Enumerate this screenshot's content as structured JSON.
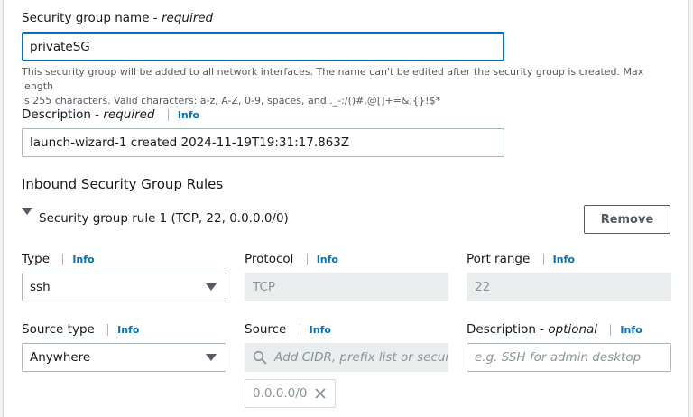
{
  "name_field": {
    "label": "Security group name - ",
    "required": "required",
    "value": "privateSG",
    "hint_line1": "This security group will be added to all network interfaces. The name can't be edited after the security group is created. Max length",
    "hint_line2": "is 255 characters. Valid characters: a-z, A-Z, 0-9, spaces, and ._-:/()#,@[]+=&;{}!$*"
  },
  "description_field": {
    "label": "Description - ",
    "required": "required",
    "info": "Info",
    "value": "launch-wizard-1 created 2024-11-19T19:31:17.863Z"
  },
  "inbound": {
    "heading": "Inbound Security Group Rules",
    "rule_title": "Security group rule 1 (TCP, 22, 0.0.0.0/0)",
    "remove_label": "Remove",
    "type": {
      "label": "Type",
      "info": "Info",
      "value": "ssh"
    },
    "protocol": {
      "label": "Protocol",
      "info": "Info",
      "value": "TCP"
    },
    "port_range": {
      "label": "Port range",
      "info": "Info",
      "value": "22"
    },
    "source_type": {
      "label": "Source type",
      "info": "Info",
      "value": "Anywhere"
    },
    "source": {
      "label": "Source",
      "info": "Info",
      "placeholder": "Add CIDR, prefix list or securit",
      "chip": "0.0.0.0/0"
    },
    "rule_description": {
      "label": "Description - ",
      "optional": "optional",
      "info": "Info",
      "placeholder": "e.g. SSH for admin desktop"
    }
  },
  "icons": {
    "search": "search-icon",
    "close": "close-icon",
    "dropdown": "caret-down-icon",
    "expand": "caret-down-icon"
  }
}
